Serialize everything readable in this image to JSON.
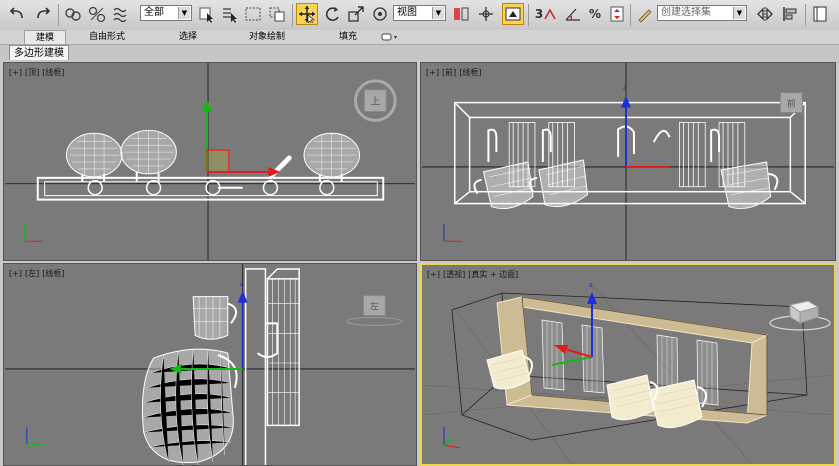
{
  "toolbar": {
    "selection_filter": "全部",
    "reference_coord": "视图",
    "snap_angle_label": "3",
    "named_selection_placeholder": "创建选择集"
  },
  "ribbon": {
    "tabs": [
      {
        "label": "建模",
        "active": true
      },
      {
        "label": "自由形式",
        "active": false
      },
      {
        "label": "选择",
        "active": false
      },
      {
        "label": "对象绘制",
        "active": false
      },
      {
        "label": "填充",
        "active": false
      }
    ],
    "subtab": "多边形建模"
  },
  "viewports": {
    "top": {
      "plus": "[+]",
      "view": "[顶]",
      "shading": "[线框]",
      "cube_label": "上"
    },
    "front": {
      "plus": "[+]",
      "view": "[前]",
      "shading": "[线框]",
      "cube_label": "前"
    },
    "left": {
      "plus": "[+]",
      "view": "[左]",
      "shading": "[线框]",
      "cube_label": "左"
    },
    "persp": {
      "plus": "[+]",
      "view": "[透视]",
      "shading": "[真实 + 边面]"
    }
  },
  "colors": {
    "viewport_bg": "#7a7a7a",
    "active_border": "#ecd64a",
    "wire": "#ffffff",
    "axis_x": "#e21a1a",
    "axis_y": "#14b814",
    "axis_z": "#1f2fd6",
    "toolbar_active": "#f7d35a",
    "wood": "#cdbb93"
  },
  "icons": [
    "undo-icon",
    "redo-icon",
    "select-link-icon",
    "unlink-icon",
    "bind-spacewarp-icon",
    "select-object-icon",
    "select-by-name-icon",
    "rect-selection-icon",
    "window-crossing-icon",
    "move-icon",
    "rotate-icon",
    "scale-icon",
    "select-manipulate-icon",
    "pivot-center-icon",
    "select-manipulate2-icon",
    "keyboard-shortcut-icon",
    "snap-toggle-icon",
    "angle-snap-icon",
    "percent-snap-icon",
    "spinner-snap-icon",
    "edit-named-sets-icon",
    "mirror-icon",
    "align-icon",
    "layer-manager-icon"
  ]
}
